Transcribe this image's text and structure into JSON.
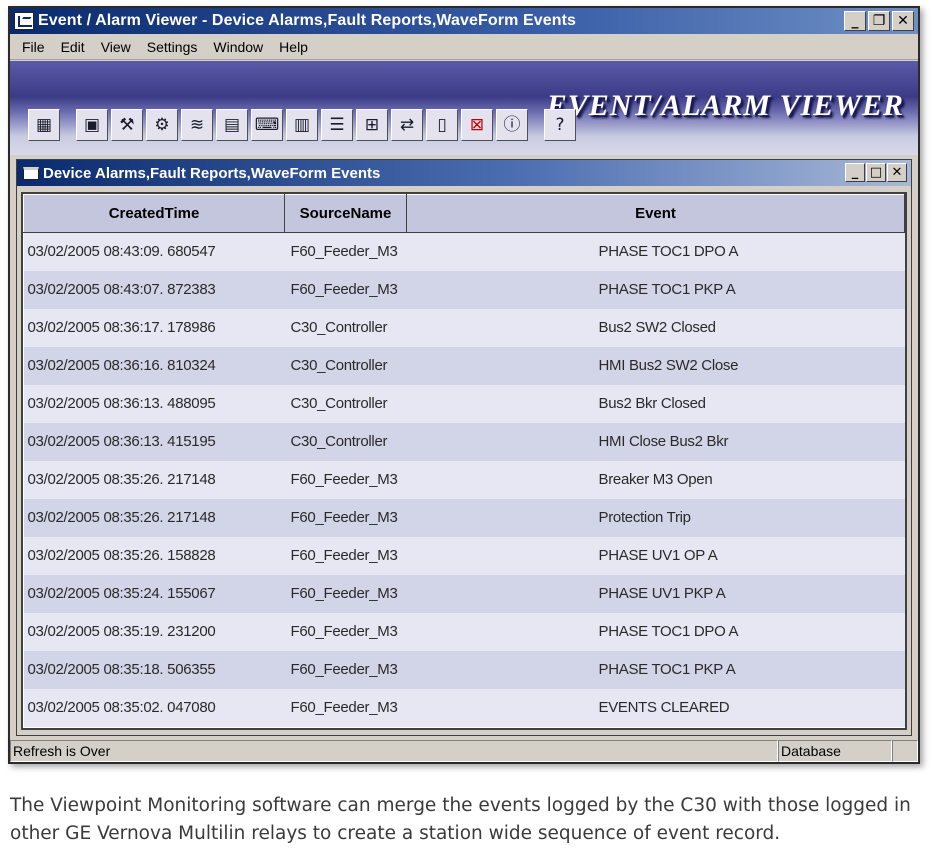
{
  "window": {
    "title": "Event / Alarm Viewer - Device Alarms,Fault Reports,WaveForm Events",
    "minimize": "_",
    "restore": "❐",
    "close": "✕"
  },
  "menu": [
    "File",
    "Edit",
    "View",
    "Settings",
    "Window",
    "Help"
  ],
  "banner": {
    "logo_text": "EVENT/ALARM VIEWER"
  },
  "toolbar": {
    "buttons": [
      {
        "name": "grid-icon",
        "glyph": "▦"
      },
      {
        "name": "device-icon",
        "glyph": "▣"
      },
      {
        "name": "tools-icon",
        "glyph": "⚒"
      },
      {
        "name": "network-icon",
        "glyph": "⚙"
      },
      {
        "name": "waveform-icon",
        "glyph": "≋"
      },
      {
        "name": "report-icon",
        "glyph": "▤"
      },
      {
        "name": "keyboard-icon",
        "glyph": "⌨"
      },
      {
        "name": "monitor-icon",
        "glyph": "▥"
      },
      {
        "name": "form-icon",
        "glyph": "☰"
      },
      {
        "name": "topology-icon",
        "glyph": "⊞"
      },
      {
        "name": "link-icon",
        "glyph": "⇄"
      },
      {
        "name": "page-icon",
        "glyph": "▯"
      },
      {
        "name": "stop-icon",
        "glyph": "⊠"
      },
      {
        "name": "info-icon",
        "glyph": "ⓘ"
      },
      {
        "name": "help-icon",
        "glyph": "?"
      }
    ]
  },
  "child_window": {
    "title": "Device Alarms,Fault Reports,WaveForm Events",
    "minimize": "_",
    "maximize": "□",
    "close": "✕"
  },
  "table": {
    "columns": [
      "CreatedTime",
      "SourceName",
      "Event"
    ],
    "rows": [
      [
        "03/02/2005 08:43:09. 680547",
        "F60_Feeder_M3",
        "PHASE TOC1 DPO A"
      ],
      [
        "03/02/2005 08:43:07. 872383",
        "F60_Feeder_M3",
        "PHASE TOC1 PKP A"
      ],
      [
        "03/02/2005 08:36:17. 178986",
        "C30_Controller",
        "Bus2 SW2 Closed"
      ],
      [
        "03/02/2005 08:36:16. 810324",
        "C30_Controller",
        "HMI Bus2 SW2 Close"
      ],
      [
        "03/02/2005 08:36:13. 488095",
        "C30_Controller",
        "Bus2 Bkr Closed"
      ],
      [
        "03/02/2005 08:36:13. 415195",
        "C30_Controller",
        "HMI Close Bus2 Bkr"
      ],
      [
        "03/02/2005 08:35:26. 217148",
        "F60_Feeder_M3",
        "Breaker M3 Open"
      ],
      [
        "03/02/2005 08:35:26. 217148",
        "F60_Feeder_M3",
        "Protection Trip"
      ],
      [
        "03/02/2005 08:35:26. 158828",
        "F60_Feeder_M3",
        "PHASE UV1 OP A"
      ],
      [
        "03/02/2005 08:35:24. 155067",
        "F60_Feeder_M3",
        "PHASE UV1 PKP A"
      ],
      [
        "03/02/2005 08:35:19. 231200",
        "F60_Feeder_M3",
        "PHASE TOC1 DPO A"
      ],
      [
        "03/02/2005 08:35:18. 506355",
        "F60_Feeder_M3",
        "PHASE TOC1 PKP A"
      ],
      [
        "03/02/2005 08:35:02. 047080",
        "F60_Feeder_M3",
        "EVENTS CLEARED"
      ]
    ]
  },
  "status": {
    "left": "Refresh is Over",
    "right": "Database"
  },
  "caption": "The Viewpoint Monitoring software can merge the events logged by the C30 with those logged in other GE Vernova Multilin relays to create a station wide sequence of event record."
}
